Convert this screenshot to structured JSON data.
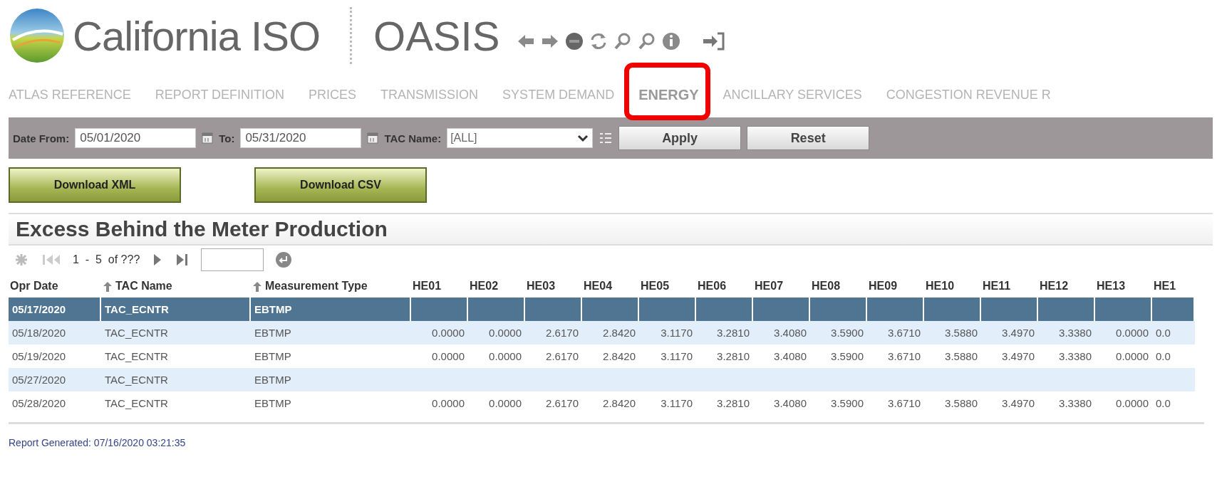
{
  "header": {
    "brand": "California ISO",
    "app": "OASIS"
  },
  "nav": [
    {
      "label": "ATLAS REFERENCE",
      "selected": false,
      "highlighted": false
    },
    {
      "label": "REPORT DEFINITION",
      "selected": false,
      "highlighted": false
    },
    {
      "label": "PRICES",
      "selected": false,
      "highlighted": false
    },
    {
      "label": "TRANSMISSION",
      "selected": false,
      "highlighted": false
    },
    {
      "label": "SYSTEM DEMAND",
      "selected": false,
      "highlighted": false
    },
    {
      "label": "ENERGY",
      "selected": true,
      "highlighted": true
    },
    {
      "label": "ANCILLARY SERVICES",
      "selected": false,
      "highlighted": false
    },
    {
      "label": "CONGESTION REVENUE R",
      "selected": false,
      "highlighted": false
    }
  ],
  "filters": {
    "date_from_label": "Date From:",
    "date_from": "05/01/2020",
    "to_label": "To:",
    "date_to": "05/31/2020",
    "tac_label": "TAC Name:",
    "tac_value": "[ALL]",
    "apply": "Apply",
    "reset": "Reset"
  },
  "downloads": [
    "Download XML",
    "Download CSV"
  ],
  "report": {
    "title": "Excess Behind the Meter Production",
    "range": "1  -  5  of ???",
    "columns": [
      {
        "label": "Opr Date",
        "sorted": false
      },
      {
        "label": "TAC Name",
        "sorted": true
      },
      {
        "label": "Measurement Type",
        "sorted": true
      },
      {
        "label": "HE01",
        "sorted": false
      },
      {
        "label": "HE02",
        "sorted": false
      },
      {
        "label": "HE03",
        "sorted": false
      },
      {
        "label": "HE04",
        "sorted": false
      },
      {
        "label": "HE05",
        "sorted": false
      },
      {
        "label": "HE06",
        "sorted": false
      },
      {
        "label": "HE07",
        "sorted": false
      },
      {
        "label": "HE08",
        "sorted": false
      },
      {
        "label": "HE09",
        "sorted": false
      },
      {
        "label": "HE10",
        "sorted": false
      },
      {
        "label": "HE11",
        "sorted": false
      },
      {
        "label": "HE12",
        "sorted": false
      },
      {
        "label": "HE13",
        "sorted": false
      },
      {
        "label": "HE1",
        "sorted": false
      }
    ],
    "rows": [
      {
        "selected": true,
        "cells": [
          "05/17/2020",
          "TAC_ECNTR",
          "EBTMP"
        ]
      },
      {
        "selected": false,
        "cells": [
          "05/18/2020",
          "TAC_ECNTR",
          "EBTMP",
          "0.0000",
          "0.0000",
          "2.6170",
          "2.8420",
          "3.1170",
          "3.2810",
          "3.4080",
          "3.5900",
          "3.6710",
          "3.5880",
          "3.4970",
          "3.3380",
          "0.0000",
          "0.0"
        ]
      },
      {
        "selected": false,
        "cells": [
          "05/19/2020",
          "TAC_ECNTR",
          "EBTMP",
          "0.0000",
          "0.0000",
          "2.6170",
          "2.8420",
          "3.1170",
          "3.2810",
          "3.4080",
          "3.5900",
          "3.6710",
          "3.5880",
          "3.4970",
          "3.3380",
          "0.0000",
          "0.0"
        ]
      },
      {
        "selected": false,
        "cells": [
          "05/27/2020",
          "TAC_ECNTR",
          "EBTMP"
        ]
      },
      {
        "selected": false,
        "cells": [
          "05/28/2020",
          "TAC_ECNTR",
          "EBTMP",
          "0.0000",
          "0.0000",
          "2.6170",
          "2.8420",
          "3.1170",
          "3.2810",
          "3.4080",
          "3.5900",
          "3.6710",
          "3.5880",
          "3.4970",
          "3.3380",
          "0.0000",
          "0.0"
        ]
      }
    ]
  },
  "footer": "Report Generated:  07/16/2020 03:21:35"
}
